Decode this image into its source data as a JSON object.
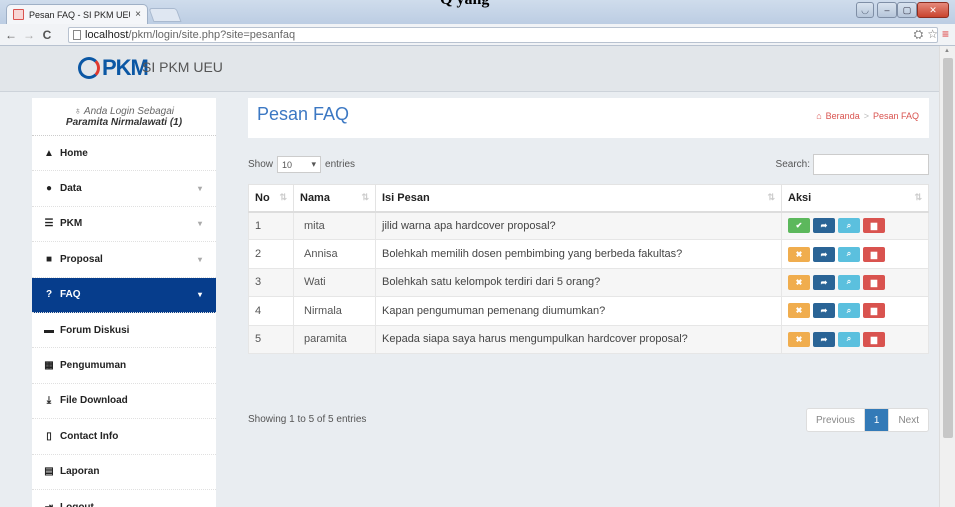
{
  "browser": {
    "tab_title": "Pesan FAQ - SI PKM UEU",
    "tab_close": "×",
    "page_heading_cut": "Q yang",
    "url_host": "localhost",
    "url_path": "/pkm/login/site.php?site=pesanfaq",
    "back_icon": "←",
    "forward_icon": "→",
    "reload_icon": "C",
    "translate_icon": "⛭",
    "star_icon": "☆",
    "menu_icon": "≡",
    "minimize_icon": "–",
    "maximize_icon": "▢",
    "close_icon": "✕",
    "user_icon": "◡"
  },
  "navbar": {
    "logo_text": "PKM",
    "brand_name": "SI PKM UEU"
  },
  "sidebar": {
    "login_line": "Anda Login Sebagai",
    "login_user": "Paramita Nirmalawati (1)",
    "items": [
      {
        "label": "Home",
        "icon": "▲",
        "has_caret": false
      },
      {
        "label": "Data",
        "icon": "●",
        "has_caret": true
      },
      {
        "label": "PKM",
        "icon": "☰",
        "has_caret": true
      },
      {
        "label": "Proposal",
        "icon": "■",
        "has_caret": true
      },
      {
        "label": "FAQ",
        "icon": "?",
        "has_caret": true
      },
      {
        "label": "Forum Diskusi",
        "icon": "▬",
        "has_caret": false
      },
      {
        "label": "Pengumuman",
        "icon": "▦",
        "has_caret": false
      },
      {
        "label": "File Download",
        "icon": "⤓",
        "has_caret": false
      },
      {
        "label": "Contact Info",
        "icon": "▯",
        "has_caret": false
      },
      {
        "label": "Laporan",
        "icon": "▤",
        "has_caret": false
      },
      {
        "label": "Logout",
        "icon": "⇥",
        "has_caret": false
      }
    ],
    "active_item": "FAQ",
    "caret_glyph": "▾"
  },
  "header": {
    "title": "Pesan FAQ",
    "home_icon": "⌂",
    "breadcrumb": [
      "Beranda",
      "Pesan FAQ"
    ],
    "separator": ">"
  },
  "table": {
    "length_prefix": "Show",
    "length_value": "10",
    "length_suffix": "entries",
    "search_label": "Search:",
    "search_value": "",
    "columns": [
      "No",
      "Nama",
      "Isi Pesan",
      "Aksi"
    ],
    "sort_icon": "⇅",
    "rows": [
      {
        "no": "1",
        "nama": "mita",
        "pesan": "jilid warna apa hardcover proposal?",
        "status": "answered"
      },
      {
        "no": "2",
        "nama": "Annisa",
        "pesan": "Bolehkah memilih dosen pembimbing yang berbeda fakultas?",
        "status": "pending"
      },
      {
        "no": "3",
        "nama": "Wati",
        "pesan": "Bolehkah satu kelompok terdiri dari 5 orang?",
        "status": "pending"
      },
      {
        "no": "4",
        "nama": "Nirmala",
        "pesan": "Kapan pengumuman pemenang diumumkan?",
        "status": "pending"
      },
      {
        "no": "5",
        "nama": "paramita",
        "pesan": "Kepada siapa saya harus mengumpulkan hardcover proposal?",
        "status": "pending"
      }
    ],
    "action_icons": {
      "answered": "✔",
      "pending": "✖",
      "forward": "➦",
      "view": "⌕",
      "delete": "▆"
    },
    "info": "Showing 1 to 5 of 5 entries",
    "pagination": {
      "previous": "Previous",
      "current": "1",
      "next": "Next"
    }
  },
  "colors": {
    "active_menu": "#063d8c",
    "title_blue": "#3c78c3",
    "breadcrumb_red": "#d9534f",
    "btn_green": "#5cb85c",
    "btn_orange": "#f0ad4e",
    "btn_blue": "#2a6496",
    "btn_cyan": "#5bc0de",
    "btn_red": "#d9534f"
  }
}
